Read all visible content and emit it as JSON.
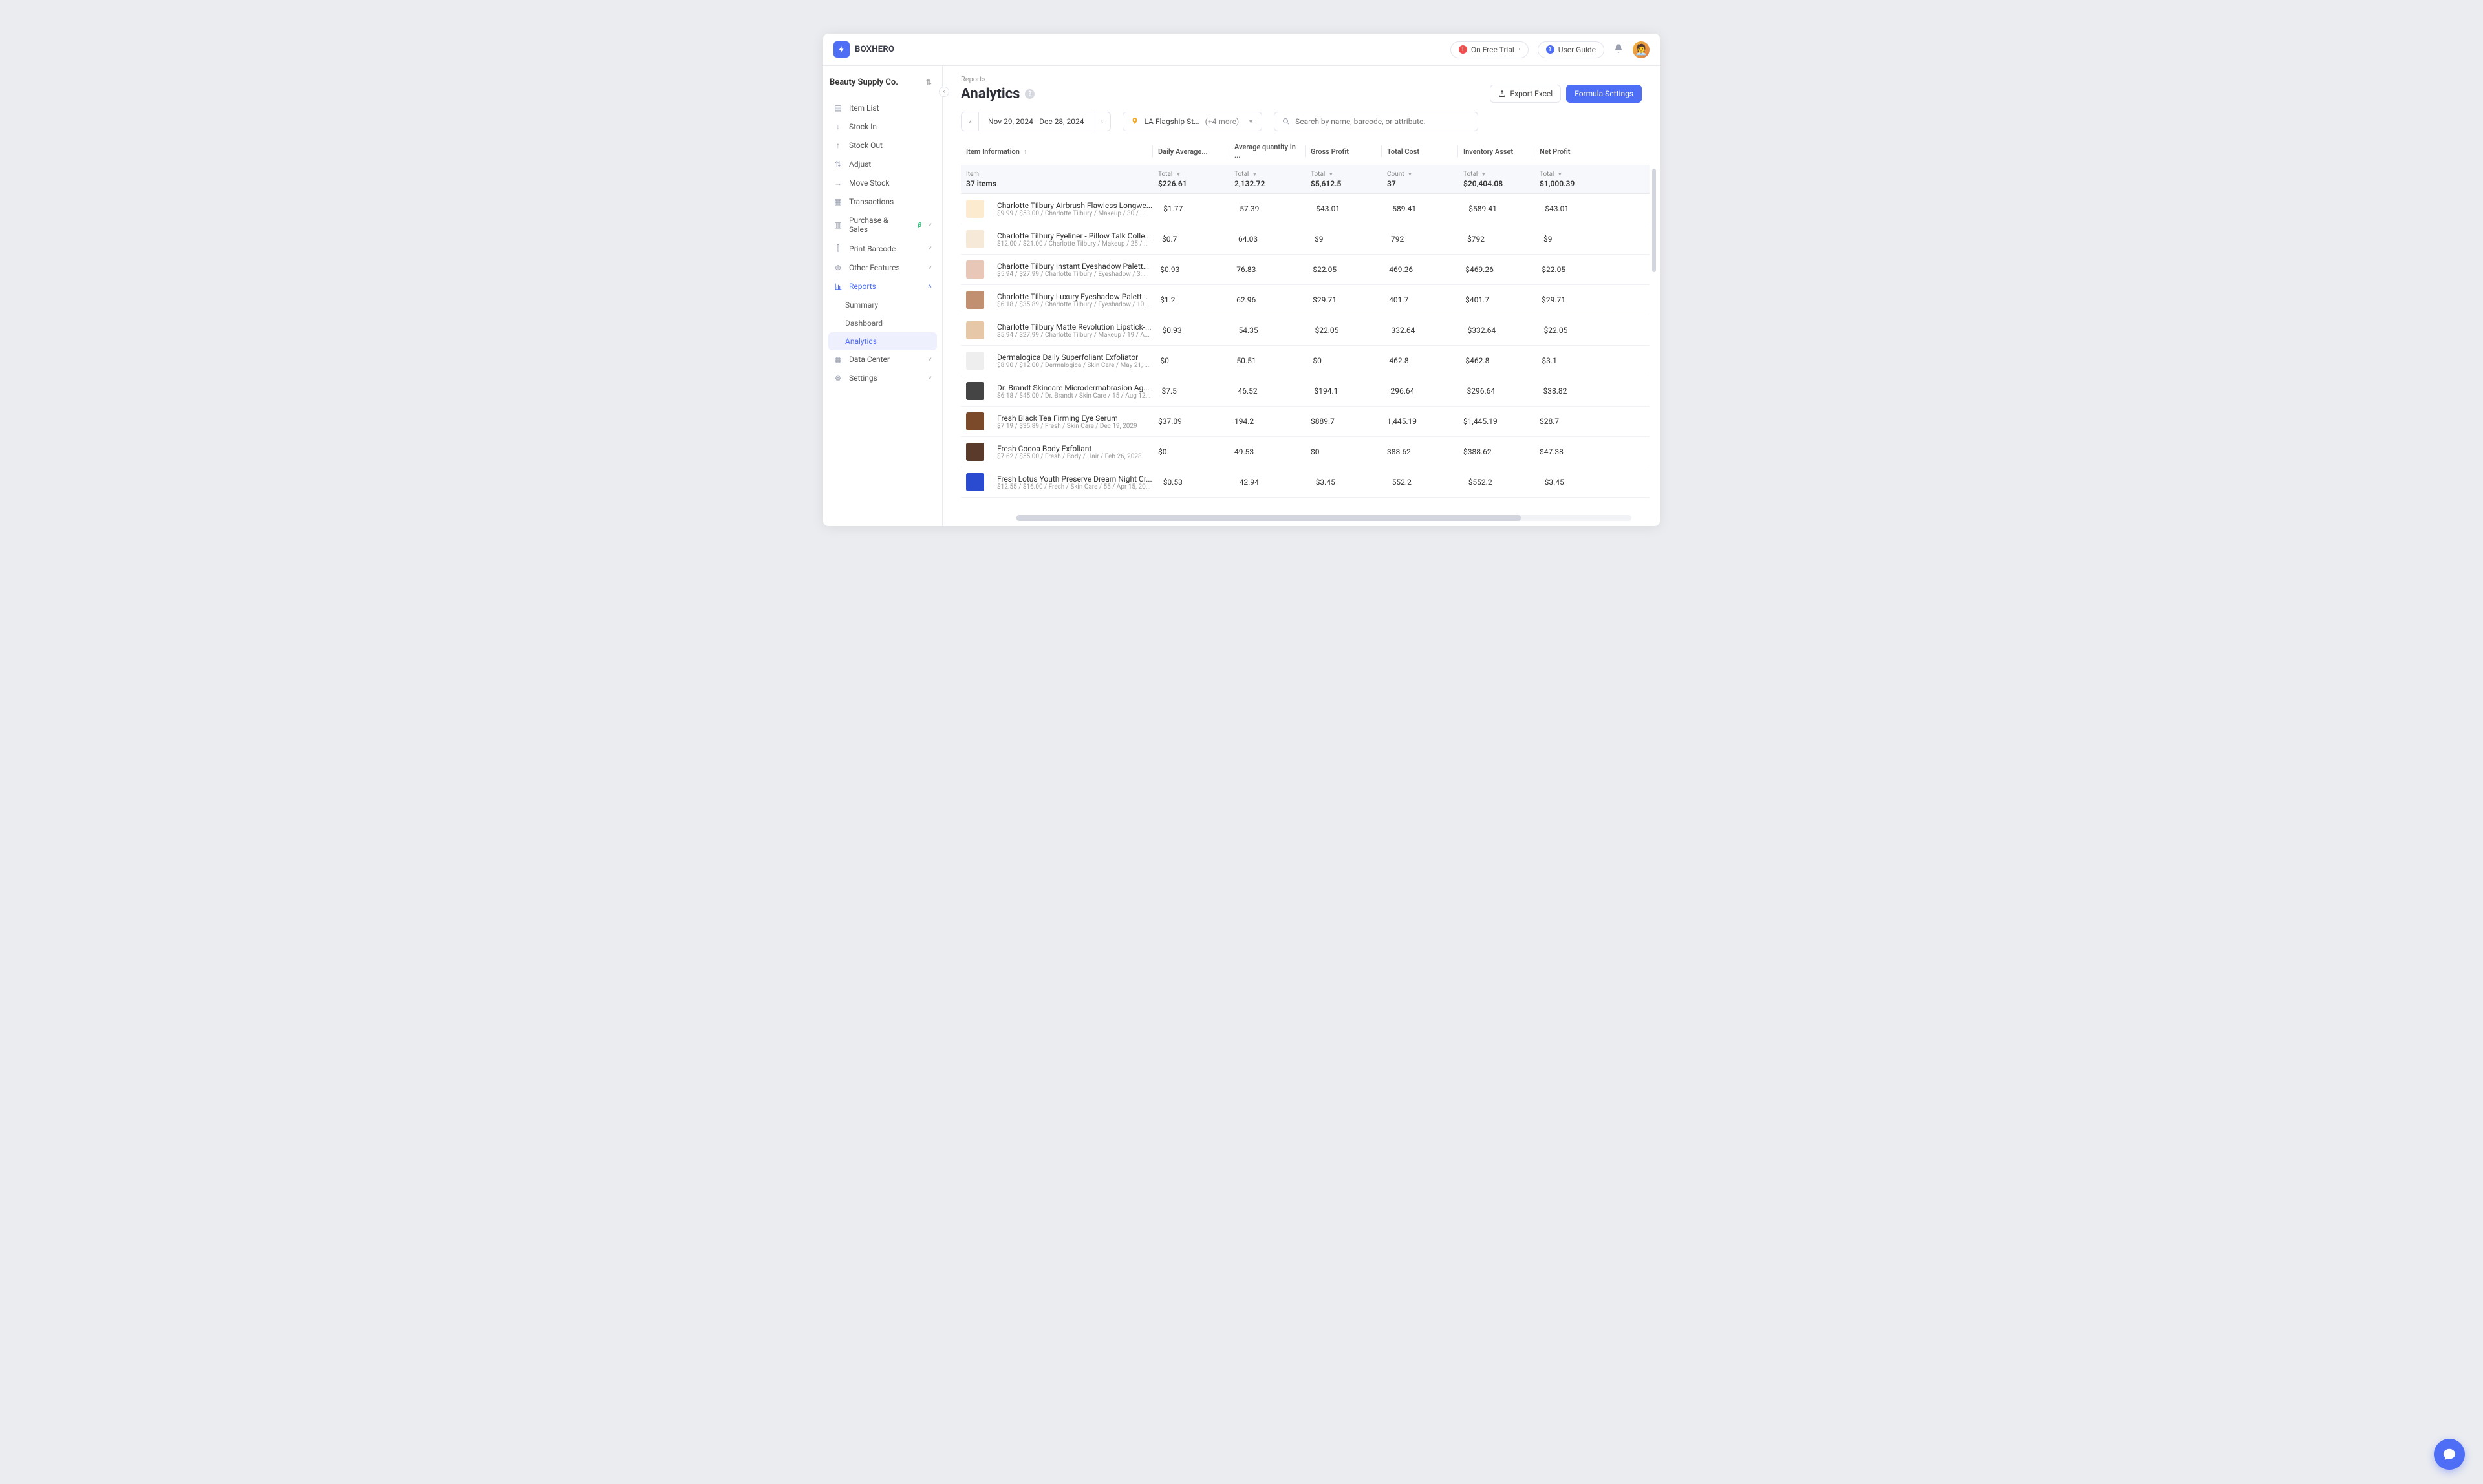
{
  "brand": "BOXHERO",
  "org": "Beauty Supply Co.",
  "header": {
    "trial_label": "On Free Trial",
    "guide_label": "User Guide"
  },
  "sidebar": {
    "items": [
      {
        "icon": "list",
        "label": "Item List"
      },
      {
        "icon": "down",
        "label": "Stock In"
      },
      {
        "icon": "up",
        "label": "Stock Out"
      },
      {
        "icon": "adjust",
        "label": "Adjust"
      },
      {
        "icon": "move",
        "label": "Move Stock"
      },
      {
        "icon": "tx",
        "label": "Transactions"
      },
      {
        "icon": "cart",
        "label": "Purchase & Sales",
        "beta": true,
        "chev": "down"
      },
      {
        "icon": "barcode",
        "label": "Print Barcode",
        "chev": "down"
      },
      {
        "icon": "plus",
        "label": "Other Features",
        "chev": "down"
      },
      {
        "icon": "chart",
        "label": "Reports",
        "chev": "up",
        "open": true
      },
      {
        "icon": "db",
        "label": "Data Center",
        "chev": "down"
      },
      {
        "icon": "gear",
        "label": "Settings",
        "chev": "down"
      }
    ],
    "reports_sub": [
      {
        "label": "Summary"
      },
      {
        "label": "Dashboard"
      },
      {
        "label": "Analytics",
        "active": true
      }
    ]
  },
  "crumb": "Reports",
  "title": "Analytics",
  "actions": {
    "export": "Export Excel",
    "formula": "Formula Settings"
  },
  "filters": {
    "date_range": "Nov 29, 2024 - Dec 28, 2024",
    "location": "LA Flagship St...",
    "location_more": "(+4 more)",
    "search_placeholder": "Search by name, barcode, or attribute."
  },
  "columns": [
    {
      "label": "Item Information",
      "sort": true
    },
    {
      "label": "Daily Average..."
    },
    {
      "label": "Average quantity in ..."
    },
    {
      "label": "Gross Profit"
    },
    {
      "label": "Total Cost"
    },
    {
      "label": "Inventory Asset"
    },
    {
      "label": "Net Profit"
    }
  ],
  "aggregate": {
    "item": {
      "label": "Item",
      "value": "37 items"
    },
    "daily": {
      "label": "Total",
      "value": "$226.61"
    },
    "avgqty": {
      "label": "Total",
      "value": "2,132.72"
    },
    "gross": {
      "label": "Total",
      "value": "$5,612.5"
    },
    "cost": {
      "label": "Count",
      "value": "37"
    },
    "asset": {
      "label": "Total",
      "value": "$20,404.08"
    },
    "net": {
      "label": "Total",
      "value": "$1,000.39"
    }
  },
  "rows": [
    {
      "thumb": "fdebd0",
      "name": "Charlotte Tilbury Airbrush Flawless Longwe...",
      "meta": "$9.99 / $53.00 / Charlotte Tilbury / Makeup / 30 / ...",
      "daily": "$1.77",
      "qty": "57.39",
      "gross": "$43.01",
      "cost": "589.41",
      "asset": "$589.41",
      "net": "$43.01"
    },
    {
      "thumb": "f7e9d8",
      "name": "Charlotte Tilbury Eyeliner - Pillow Talk Colle...",
      "meta": "$12.00 / $21.00 / Charlotte Tilbury / Makeup / 25 / ...",
      "daily": "$0.7",
      "qty": "64.03",
      "gross": "$9",
      "cost": "792",
      "asset": "$792",
      "net": "$9"
    },
    {
      "thumb": "e8c7b8",
      "name": "Charlotte Tilbury Instant Eyeshadow Palett...",
      "meta": "$5.94 / $27.99 / Charlotte Tilbury / Eyeshadow / 3...",
      "daily": "$0.93",
      "qty": "76.83",
      "gross": "$22.05",
      "cost": "469.26",
      "asset": "$469.26",
      "net": "$22.05"
    },
    {
      "thumb": "c19070",
      "name": "Charlotte Tilbury Luxury Eyeshadow Palett...",
      "meta": "$6.18 / $35.89 / Charlotte Tilbury / Eyeshadow / 10...",
      "daily": "$1.2",
      "qty": "62.96",
      "gross": "$29.71",
      "cost": "401.7",
      "asset": "$401.7",
      "net": "$29.71"
    },
    {
      "thumb": "e6c8a8",
      "name": "Charlotte Tilbury Matte Revolution Lipstick-...",
      "meta": "$5.94 / $27.99 / Charlotte Tilbury / Makeup / 19 / A...",
      "daily": "$0.93",
      "qty": "54.35",
      "gross": "$22.05",
      "cost": "332.64",
      "asset": "$332.64",
      "net": "$22.05"
    },
    {
      "thumb": "eeeeee",
      "name": "Dermalogica Daily Superfoliant Exfoliator",
      "meta": "$8.90 / $12.00 / Dermalogica / Skin Care / May 21, ...",
      "daily": "$0",
      "qty": "50.51",
      "gross": "$0",
      "cost": "462.8",
      "asset": "$462.8",
      "net": "$3.1"
    },
    {
      "thumb": "444444",
      "name": "Dr. Brandt Skincare Microdermabrasion Ag...",
      "meta": "$6.18 / $45.00 / Dr. Brandt / Skin Care / 15 / Aug 12...",
      "daily": "$7.5",
      "qty": "46.52",
      "gross": "$194.1",
      "cost": "296.64",
      "asset": "$296.64",
      "net": "$38.82"
    },
    {
      "thumb": "7a4a2a",
      "name": "Fresh Black Tea Firming Eye Serum",
      "meta": "$7.19 / $35.89 / Fresh / Skin Care / Dec 19, 2029",
      "daily": "$37.09",
      "qty": "194.2",
      "gross": "$889.7",
      "cost": "1,445.19",
      "asset": "$1,445.19",
      "net": "$28.7"
    },
    {
      "thumb": "5a3a2a",
      "name": "Fresh Cocoa Body Exfoliant",
      "meta": "$7.62 / $55.00 / Fresh / Body / Hair / Feb 26, 2028",
      "daily": "$0",
      "qty": "49.53",
      "gross": "$0",
      "cost": "388.62",
      "asset": "$388.62",
      "net": "$47.38"
    },
    {
      "thumb": "2a4ad0",
      "name": "Fresh Lotus Youth Preserve Dream Night Cr...",
      "meta": "$12.55 / $16.00 / Fresh / Skin Care / 55 / Apr 15, 20...",
      "daily": "$0.53",
      "qty": "42.94",
      "gross": "$3.45",
      "cost": "552.2",
      "asset": "$552.2",
      "net": "$3.45"
    }
  ]
}
